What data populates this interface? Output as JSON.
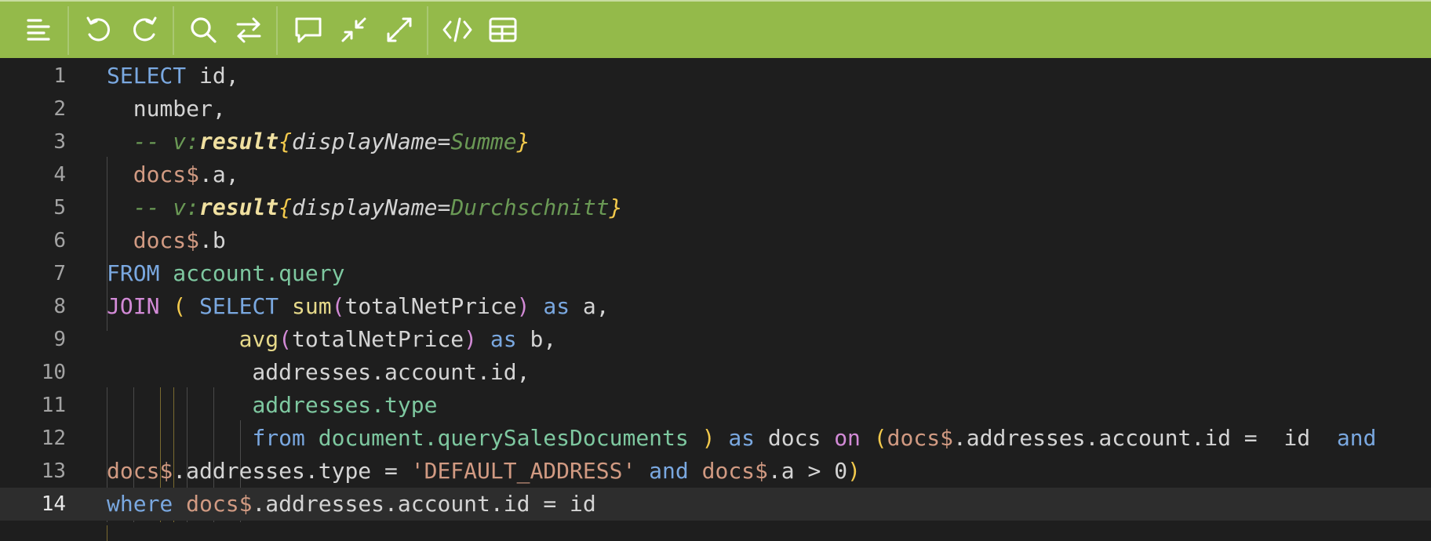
{
  "toolbar": {
    "items": [
      {
        "name": "menu-icon"
      },
      {
        "name": "undo-icon"
      },
      {
        "name": "redo-icon"
      },
      {
        "name": "search-icon"
      },
      {
        "name": "replace-icon"
      },
      {
        "name": "comment-icon"
      },
      {
        "name": "collapse-icon"
      },
      {
        "name": "expand-icon"
      },
      {
        "name": "code-icon"
      },
      {
        "name": "table-icon"
      }
    ],
    "bg_color": "#94ba4a"
  },
  "editor": {
    "active_line": 14,
    "lines": [
      {
        "n": "1",
        "tokens": [
          [
            "kw",
            "SELECT"
          ],
          [
            "t",
            " id,"
          ]
        ]
      },
      {
        "n": "2",
        "tokens": [
          [
            "t",
            "  number,"
          ]
        ]
      },
      {
        "n": "3",
        "tokens": [
          [
            "cm",
            "  -- v:"
          ],
          [
            "cmk",
            "result"
          ],
          [
            "cmb",
            "{"
          ],
          [
            "cmt",
            "displayName="
          ],
          [
            "cm",
            "Summe"
          ],
          [
            "cmb",
            "}"
          ]
        ]
      },
      {
        "n": "4",
        "tokens": [
          [
            "var",
            "  docs$"
          ],
          [
            "t",
            ".a,"
          ]
        ]
      },
      {
        "n": "5",
        "tokens": [
          [
            "cm",
            "  -- v:"
          ],
          [
            "cmk",
            "result"
          ],
          [
            "cmb",
            "{"
          ],
          [
            "cmt",
            "displayName="
          ],
          [
            "cm",
            "Durchschnitt"
          ],
          [
            "cmb",
            "}"
          ]
        ]
      },
      {
        "n": "6",
        "tokens": [
          [
            "var",
            "  docs$"
          ],
          [
            "t",
            ".b"
          ]
        ]
      },
      {
        "n": "7",
        "tokens": [
          [
            "kw",
            "FROM"
          ],
          [
            "t",
            " "
          ],
          [
            "tbl",
            "account.query"
          ]
        ]
      },
      {
        "n": "8",
        "tokens": [
          [
            "par",
            "JOIN"
          ],
          [
            "t",
            " "
          ],
          [
            "pary",
            "("
          ],
          [
            "t",
            " "
          ],
          [
            "kw",
            "SELECT"
          ],
          [
            "t",
            " "
          ],
          [
            "fn",
            "sum"
          ],
          [
            "par",
            "("
          ],
          [
            "t",
            "totalNetPrice"
          ],
          [
            "par",
            ")"
          ],
          [
            "t",
            " "
          ],
          [
            "kw",
            "as"
          ],
          [
            "t",
            " a,"
          ]
        ]
      },
      {
        "n": "9",
        "tokens": [
          [
            "t",
            "          "
          ],
          [
            "fn",
            "avg"
          ],
          [
            "par",
            "("
          ],
          [
            "t",
            "totalNetPrice"
          ],
          [
            "par",
            ")"
          ],
          [
            "t",
            " "
          ],
          [
            "kw",
            "as"
          ],
          [
            "t",
            " b,"
          ]
        ]
      },
      {
        "n": "10",
        "tokens": [
          [
            "t",
            "           addresses.account.id,"
          ]
        ]
      },
      {
        "n": "11",
        "tokens": [
          [
            "t",
            "           "
          ],
          [
            "tbl",
            "addresses.type"
          ]
        ]
      },
      {
        "n": "12",
        "tokens": [
          [
            "t",
            "           "
          ],
          [
            "kw",
            "from"
          ],
          [
            "t",
            " "
          ],
          [
            "tbl",
            "document.querySalesDocuments"
          ],
          [
            "t",
            " "
          ],
          [
            "pary",
            ")"
          ],
          [
            "t",
            " "
          ],
          [
            "kw",
            "as"
          ],
          [
            "t",
            " docs "
          ],
          [
            "par",
            "on"
          ],
          [
            "t",
            " "
          ],
          [
            "pary",
            "("
          ],
          [
            "var",
            "docs$"
          ],
          [
            "t",
            ".addresses.account.id =  id  "
          ],
          [
            "kw",
            "and"
          ]
        ]
      },
      {
        "n": "13",
        "tokens": [
          [
            "var",
            "docs$"
          ],
          [
            "t",
            ".addresses.type = "
          ],
          [
            "str",
            "'DEFAULT_ADDRESS'"
          ],
          [
            "t",
            " "
          ],
          [
            "kw",
            "and"
          ],
          [
            "t",
            " "
          ],
          [
            "var",
            "docs$"
          ],
          [
            "t",
            ".a > 0"
          ],
          [
            "pary",
            ")"
          ]
        ]
      },
      {
        "n": "14",
        "tokens": [
          [
            "kw",
            "where"
          ],
          [
            "t",
            " "
          ],
          [
            "var",
            "docs$"
          ],
          [
            "t",
            ".addresses.account.id = id"
          ]
        ]
      }
    ]
  }
}
